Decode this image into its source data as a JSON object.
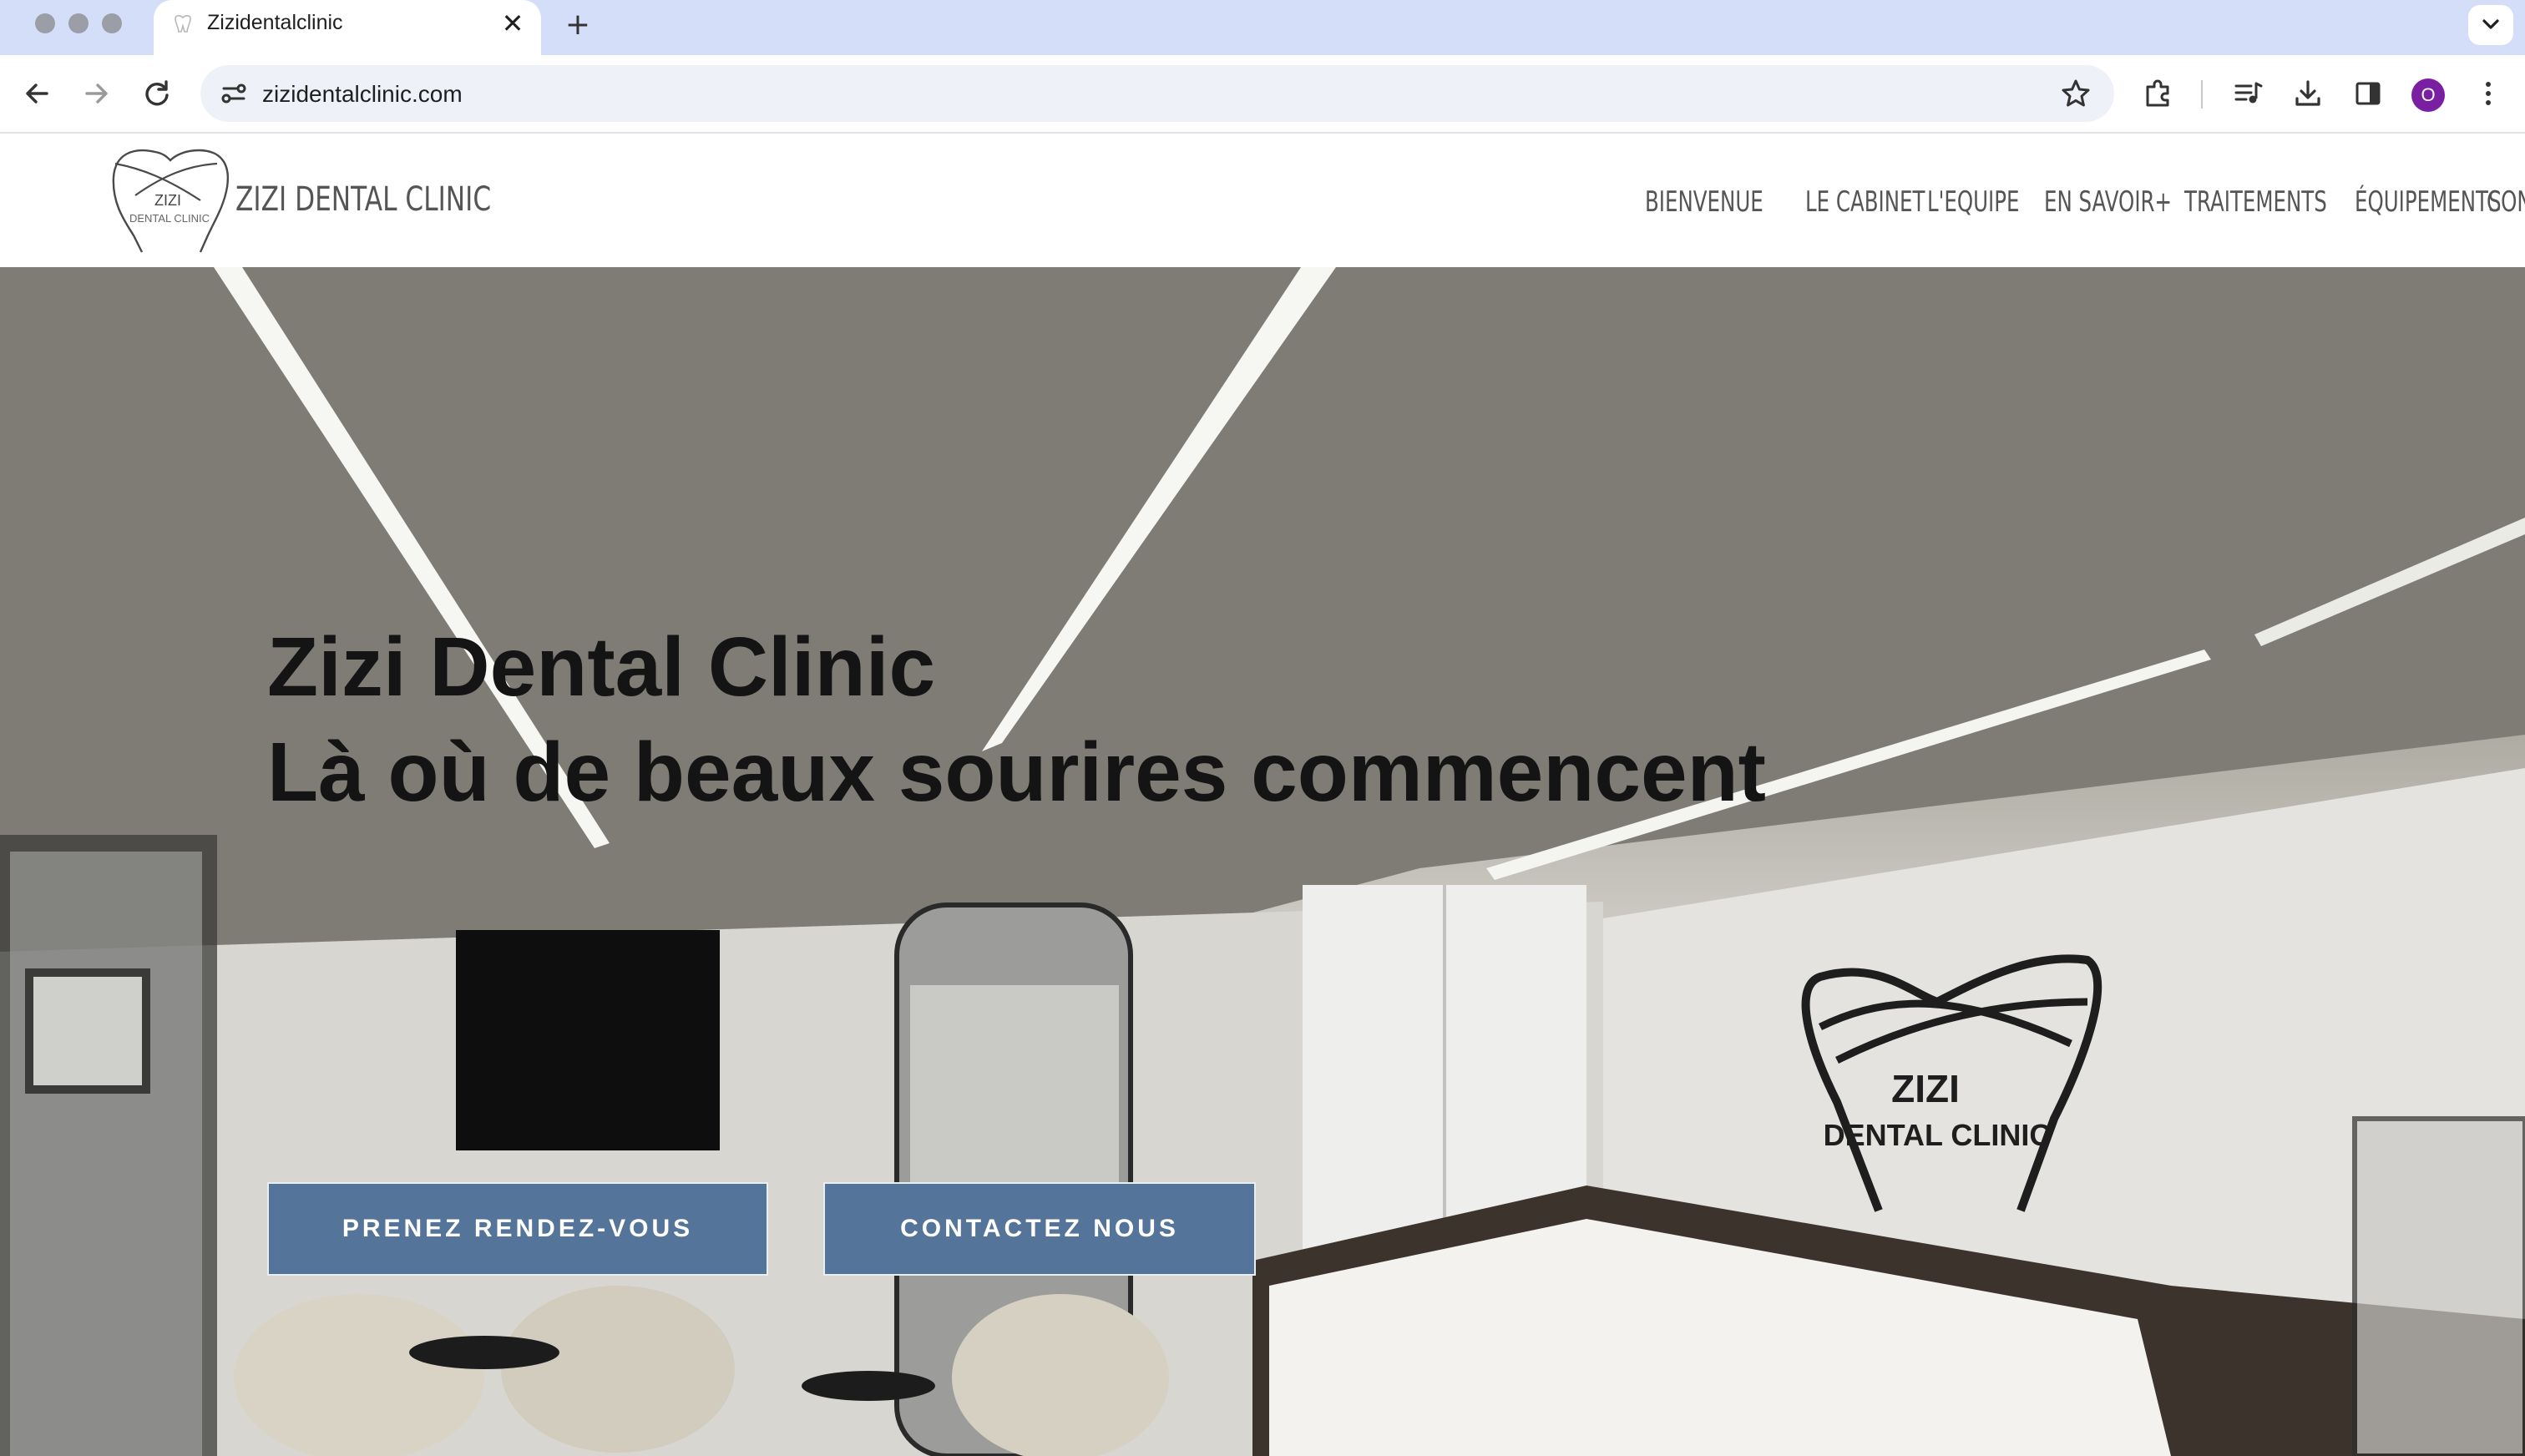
{
  "browser": {
    "tab": {
      "title": "Zizidentalclinic",
      "close_glyph": "✕"
    },
    "new_tab_glyph": "+",
    "address_bar": {
      "url": "zizidentalclinic.com"
    },
    "profile_initial": "O"
  },
  "site": {
    "logo": {
      "text": "ZIZI DENTAL CLINIC",
      "mark_line1": "ZIZI",
      "mark_line2": "DENTAL CLINIC"
    },
    "nav": [
      {
        "label": "BIENVENUE"
      },
      {
        "label": "LE CABINET"
      },
      {
        "label": "L'EQUIPE"
      },
      {
        "label": "EN SAVOIR+"
      },
      {
        "label": "TRAITEMENTS"
      },
      {
        "label": "ÉQUIPEMENTS"
      },
      {
        "label": "CONTACT"
      }
    ]
  },
  "hero": {
    "title": "Zizi Dental Clinic",
    "subtitle": "Là où de beaux sourires commencent",
    "buttons": {
      "appointment": "PRENEZ RENDEZ-VOUS",
      "contact": "CONTACTEZ NOUS"
    },
    "wall_sign": {
      "line1": "ZIZI",
      "line2": "DENTAL CLINIC"
    }
  },
  "colors": {
    "tab_strip": "#d4def8",
    "cta_background": "#54749a",
    "nav_text": "#555555",
    "hero_text": "#141414",
    "avatar": "#7b1fa2"
  }
}
